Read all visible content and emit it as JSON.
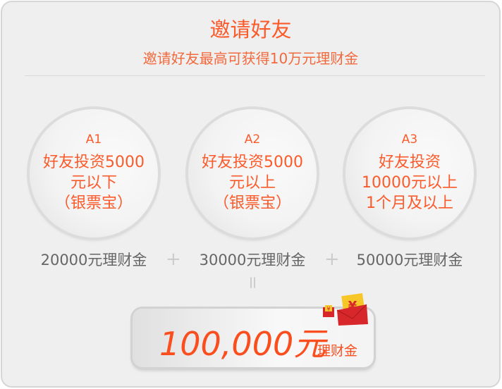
{
  "header": {
    "title": "邀请好友",
    "subtitle": "邀请好友最高可获得10万元理财金"
  },
  "tiers": [
    {
      "code": "A1",
      "lines": [
        "好友投资5000",
        "元以下",
        "（银票宝）"
      ],
      "reward": "20000元理财金"
    },
    {
      "code": "A2",
      "lines": [
        "好友投资5000",
        "元以上",
        "（银票宝）"
      ],
      "reward": "30000元理财金"
    },
    {
      "code": "A3",
      "lines": [
        "好友投资",
        "10000元以上",
        "1个月及以上"
      ],
      "reward": "50000元理财金"
    }
  ],
  "operators": {
    "plus": "+",
    "equals": "="
  },
  "total": {
    "amount": "100,000元",
    "unit": "理财金"
  },
  "colors": {
    "accent": "#fb5a2b",
    "envelope": "#d8272b",
    "coin": "#f7c627"
  }
}
